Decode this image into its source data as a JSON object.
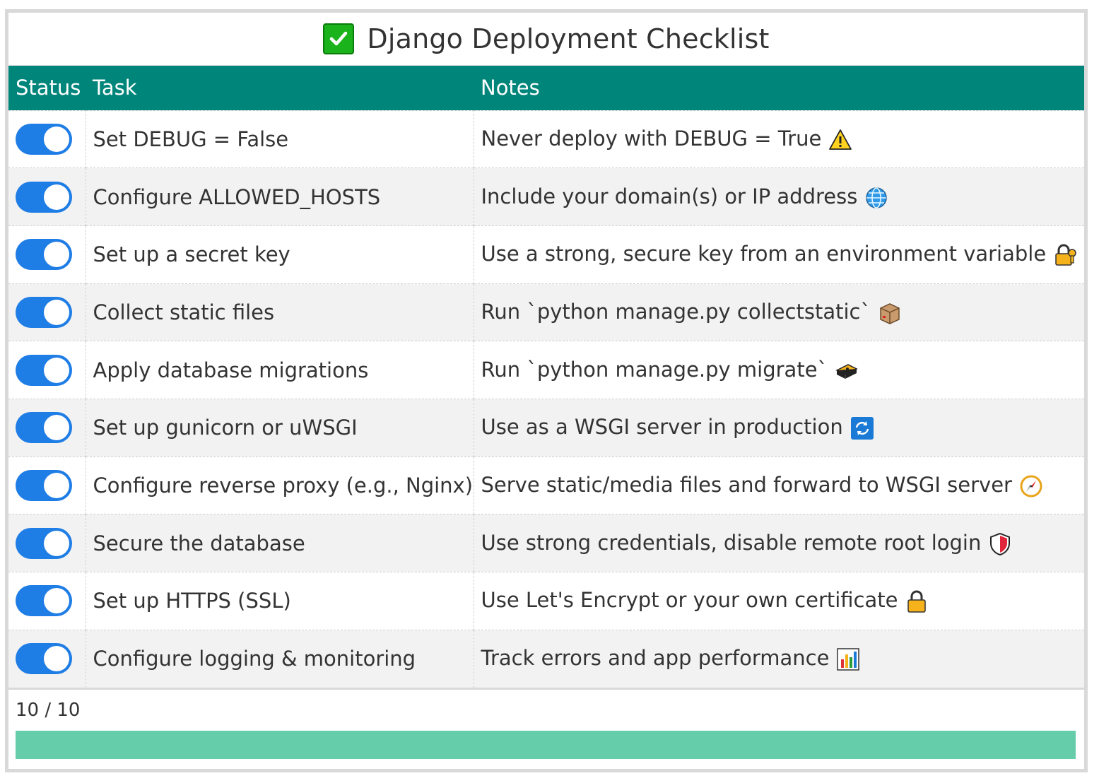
{
  "title": {
    "icon": "check-mark-icon",
    "text": "Django Deployment Checklist"
  },
  "table": {
    "headers": {
      "status": "Status",
      "task": "Task",
      "notes": "Notes"
    },
    "rows": [
      {
        "enabled": true,
        "task": "Set DEBUG = False",
        "note": "Never deploy with DEBUG = True",
        "icon": "warning-icon"
      },
      {
        "enabled": true,
        "task": "Configure ALLOWED_HOSTS",
        "note": "Include your domain(s) or IP address",
        "icon": "globe-icon"
      },
      {
        "enabled": true,
        "task": "Set up a secret key",
        "note": "Use a strong, secure key from an environment variable",
        "icon": "lock-with-key-icon"
      },
      {
        "enabled": true,
        "task": "Collect static files",
        "note": "Run `python manage.py collectstatic`",
        "icon": "package-icon"
      },
      {
        "enabled": true,
        "task": "Apply database migrations",
        "note": "Run `python manage.py migrate`",
        "icon": "database-icon"
      },
      {
        "enabled": true,
        "task": "Set up gunicorn or uWSGI",
        "note": "Use as a WSGI server in production",
        "icon": "refresh-icon"
      },
      {
        "enabled": true,
        "task": "Configure reverse proxy (e.g., Nginx)",
        "note": "Serve static/media files and forward to WSGI server",
        "icon": "compass-icon"
      },
      {
        "enabled": true,
        "task": "Secure the database",
        "note": "Use strong credentials, disable remote root login",
        "icon": "shield-icon"
      },
      {
        "enabled": true,
        "task": "Set up HTTPS (SSL)",
        "note": "Use Let's Encrypt or your own certificate",
        "icon": "lock-icon"
      },
      {
        "enabled": true,
        "task": "Configure logging & monitoring",
        "note": "Track errors and app performance",
        "icon": "bar-chart-icon"
      }
    ]
  },
  "footer": {
    "count_text": "10 / 10",
    "progress": 1.0
  },
  "colors": {
    "header_bg": "#00857a",
    "toggle_on": "#1f7de6",
    "progress_fill": "#66cdaa"
  }
}
